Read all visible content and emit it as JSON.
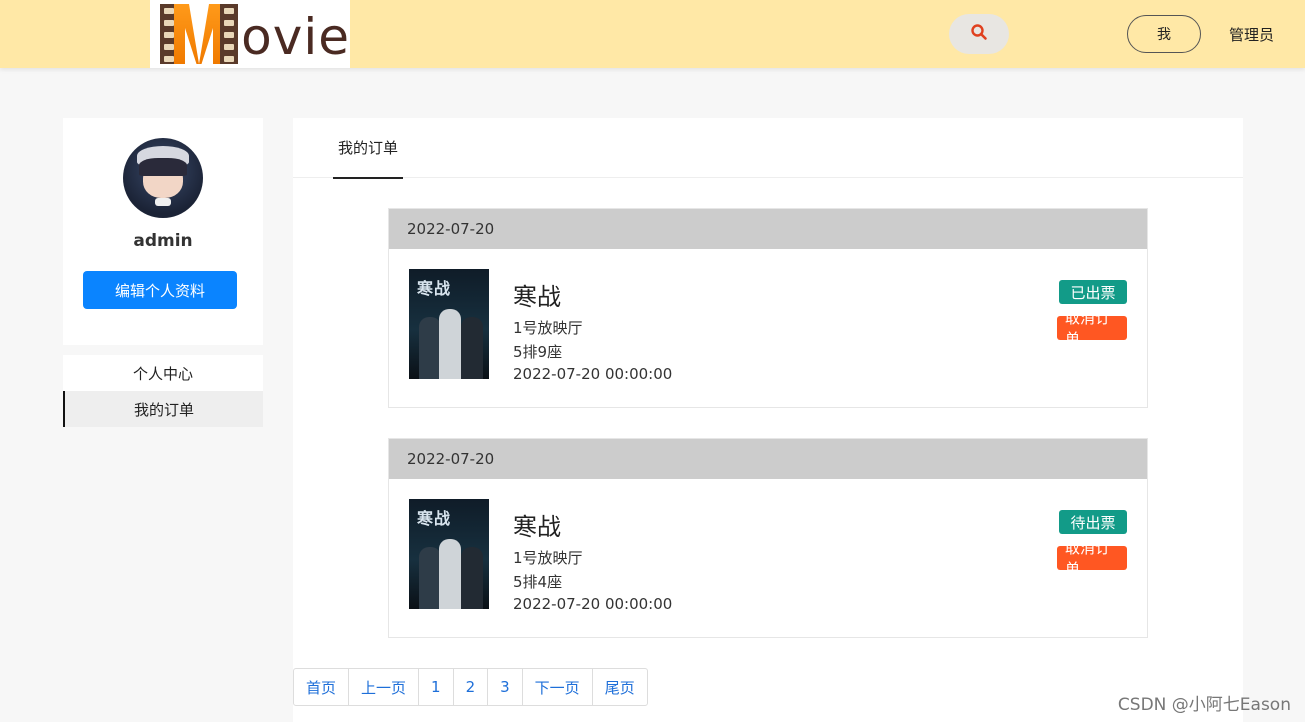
{
  "header": {
    "logo_text": "ovie",
    "me_label": "我",
    "admin_label": "管理员"
  },
  "profile": {
    "username": "admin",
    "edit_label": "编辑个人资料"
  },
  "side_menu": [
    {
      "label": "个人中心",
      "active": false
    },
    {
      "label": "我的订单",
      "active": true
    }
  ],
  "main": {
    "tab_label": "我的订单",
    "orders": [
      {
        "date": "2022-07-20",
        "poster_title": "寒战",
        "title": "寒战",
        "hall": "1号放映厅",
        "seat": "5排9座",
        "time": "2022-07-20 00:00:00",
        "status": "已出票",
        "cancel": "取消订单"
      },
      {
        "date": "2022-07-20",
        "poster_title": "寒战",
        "title": "寒战",
        "hall": "1号放映厅",
        "seat": "5排4座",
        "time": "2022-07-20 00:00:00",
        "status": "待出票",
        "cancel": "取消订单"
      }
    ]
  },
  "pagination": [
    "首页",
    "上一页",
    "1",
    "2",
    "3",
    "下一页",
    "尾页"
  ],
  "watermark": "CSDN @小阿七Eason",
  "colors": {
    "header_bg": "#ffe8a6",
    "primary_button": "#0a84ff",
    "status_badge": "#129b88",
    "cancel_badge": "#ff5722",
    "order_header_bg": "#cccccc",
    "link": "#1e6fd9"
  }
}
